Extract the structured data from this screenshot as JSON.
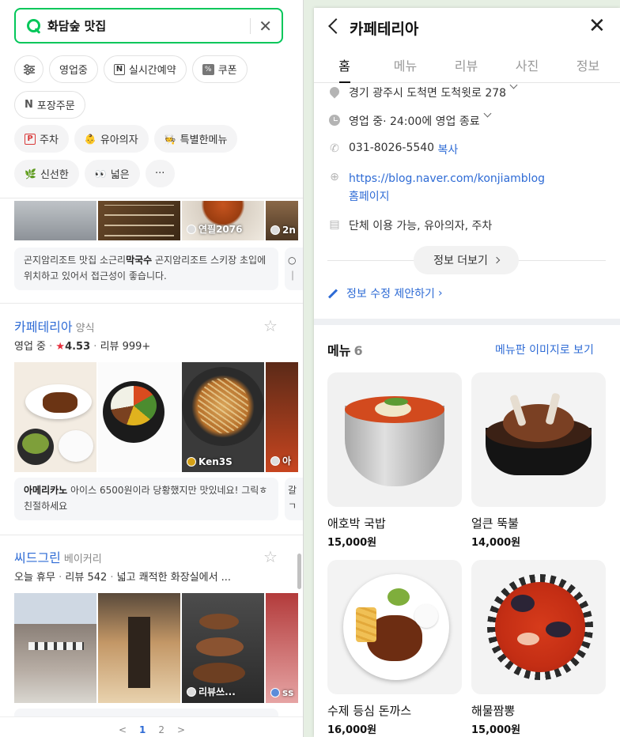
{
  "search": {
    "query": "화담숲 맛집"
  },
  "filters": {
    "row1": [
      "영업중",
      "실시간예약",
      "쿠폰"
    ],
    "row2": [
      "포장주문"
    ],
    "row3": [
      "주차",
      "유아의자",
      "특별한메뉴"
    ],
    "row4": [
      "신선한",
      "넓은"
    ],
    "more": "···"
  },
  "result0": {
    "photo_credits": [
      "연필2076",
      "2n"
    ],
    "snippet_lead": "곤지암리조트 맛집 소근리",
    "snippet_bold": "막국수",
    "snippet_rest": " 곤지암리조트 스키장 초입에 위치하고 있어서 접근성이 좋습니다."
  },
  "result1": {
    "name": "카페테리아",
    "category": "양식",
    "status": "영업 중",
    "rating": "4.53",
    "reviews": "리뷰 999+",
    "photo_credits": [
      "Ken3S",
      "아"
    ],
    "snippet_bold": "아메리카노",
    "snippet_rest": " 아이스 6500원이라 당황했지만 맛있네요! 그릭ㅎ 친절하세요"
  },
  "result2": {
    "name": "씨드그린",
    "category": "베이커리",
    "status": "오늘 휴무",
    "reviews": "리뷰 542",
    "extra": "넓고 쾌적한 화장실에서 ...",
    "photo_credits": [
      "리뷰쓰...",
      "ss"
    ]
  },
  "pager": {
    "prev": "<",
    "p1": "1",
    "p2": "2",
    "next": ">"
  },
  "detail": {
    "title": "카페테리아",
    "tabs": [
      "홈",
      "메뉴",
      "리뷰",
      "사진",
      "정보"
    ],
    "address": "경기 광주시 도척면 도척윗로 278",
    "hours_status": "영업 중",
    "hours_detail": " · 24:00에 영업 종료",
    "phone": "031-8026-5540",
    "copy": "복사",
    "url": "https://blog.naver.com/konjiamblog",
    "homepage": "홈페이지",
    "facilities": "단체 이용 가능, 유아의자, 주차",
    "more_info": "정보 더보기",
    "suggest_edit": "정보 수정 제안하기",
    "menu_title": "메뉴",
    "menu_count": "6",
    "menu_images": "메뉴판 이미지로 보기",
    "menu": [
      {
        "name": "애호박 국밥",
        "price": "15,000원"
      },
      {
        "name": "얼큰 뚝불",
        "price": "14,000원"
      },
      {
        "name": "수제 등심 돈까스",
        "price": "16,000원"
      },
      {
        "name": "해물짬뽕",
        "price": "15,000원"
      }
    ]
  },
  "colors": {
    "accent": "#03c75a",
    "link": "#2e6bd5",
    "star": "#e62e3c"
  },
  "icons": [
    "search-icon",
    "clear-icon",
    "filter-icon",
    "back-icon",
    "close-icon",
    "location-icon",
    "clock-icon",
    "phone-icon",
    "globe-icon",
    "building-icon",
    "pencil-icon",
    "star-icon"
  ]
}
